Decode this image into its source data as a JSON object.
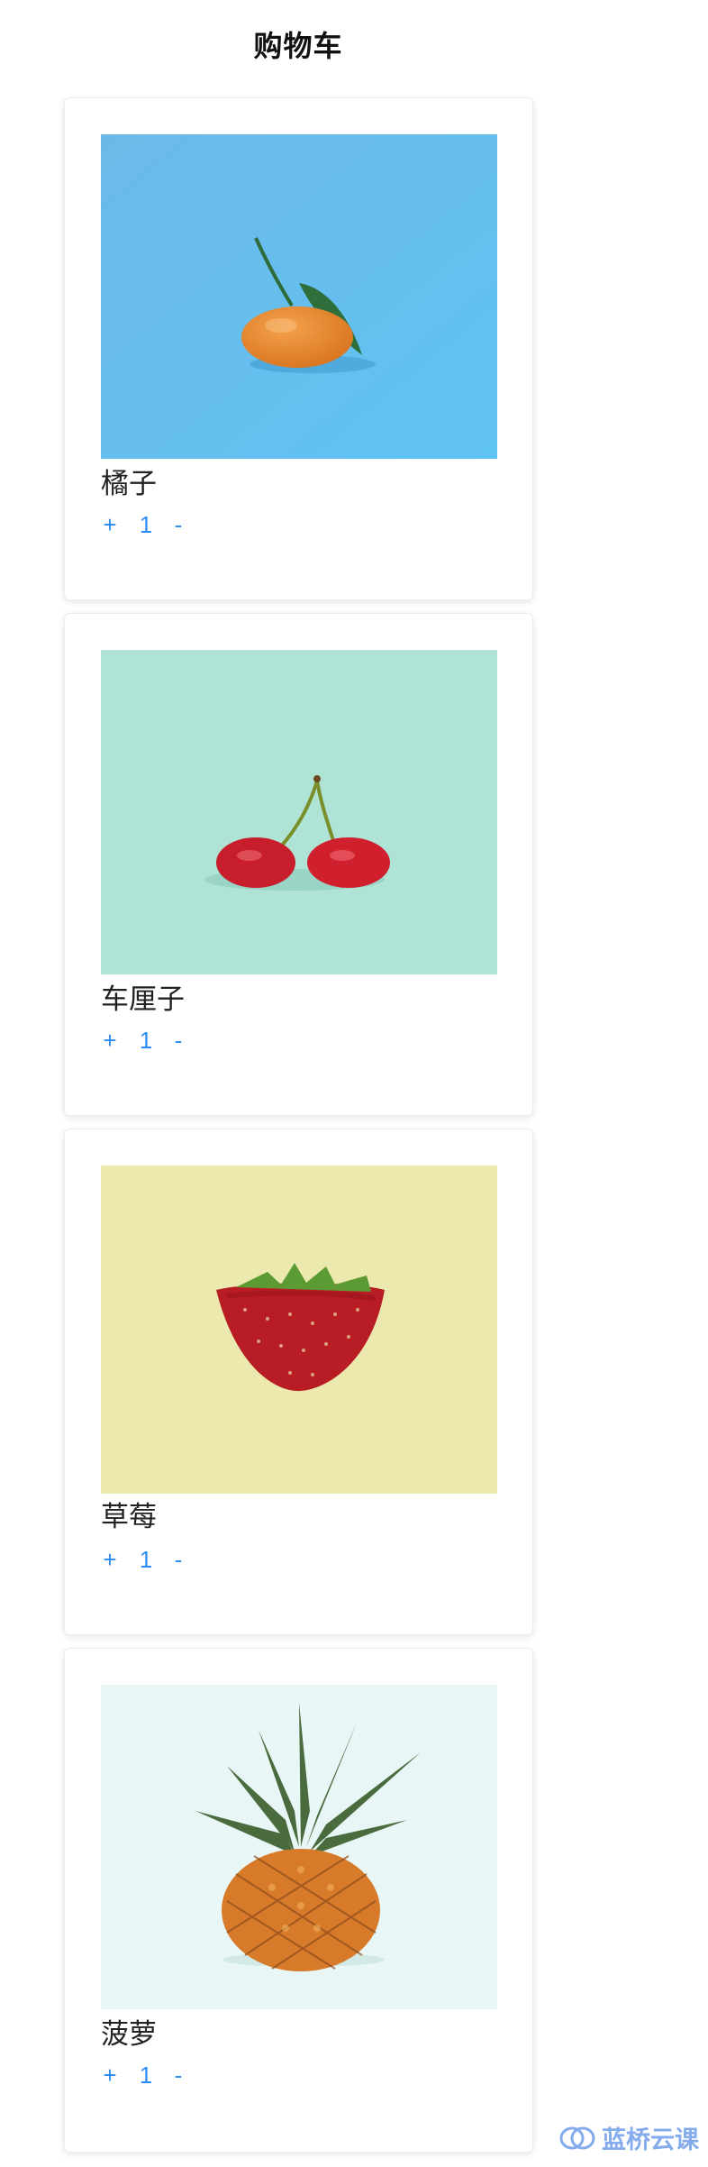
{
  "page": {
    "title": "购物车"
  },
  "products": [
    {
      "name": "橘子",
      "quantity": "1",
      "increment_label": "+",
      "decrement_label": "-",
      "image_icon": "orange-photo",
      "image_bg": "#5fb6ec"
    },
    {
      "name": "车厘子",
      "quantity": "1",
      "increment_label": "+",
      "decrement_label": "-",
      "image_icon": "cherry-photo",
      "image_bg": "#aee3d6"
    },
    {
      "name": "草莓",
      "quantity": "1",
      "increment_label": "+",
      "decrement_label": "-",
      "image_icon": "strawberry-photo",
      "image_bg": "#ebe9ad"
    },
    {
      "name": "菠萝",
      "quantity": "1",
      "increment_label": "+",
      "decrement_label": "-",
      "image_icon": "pineapple-photo",
      "image_bg": "#e8f7f6"
    }
  ],
  "watermark": {
    "text": "蓝桥云课",
    "icon": "lanqiao-logo"
  },
  "colors": {
    "accent": "#2d8cf0",
    "card_border": "#ececec",
    "text": "#222222"
  }
}
